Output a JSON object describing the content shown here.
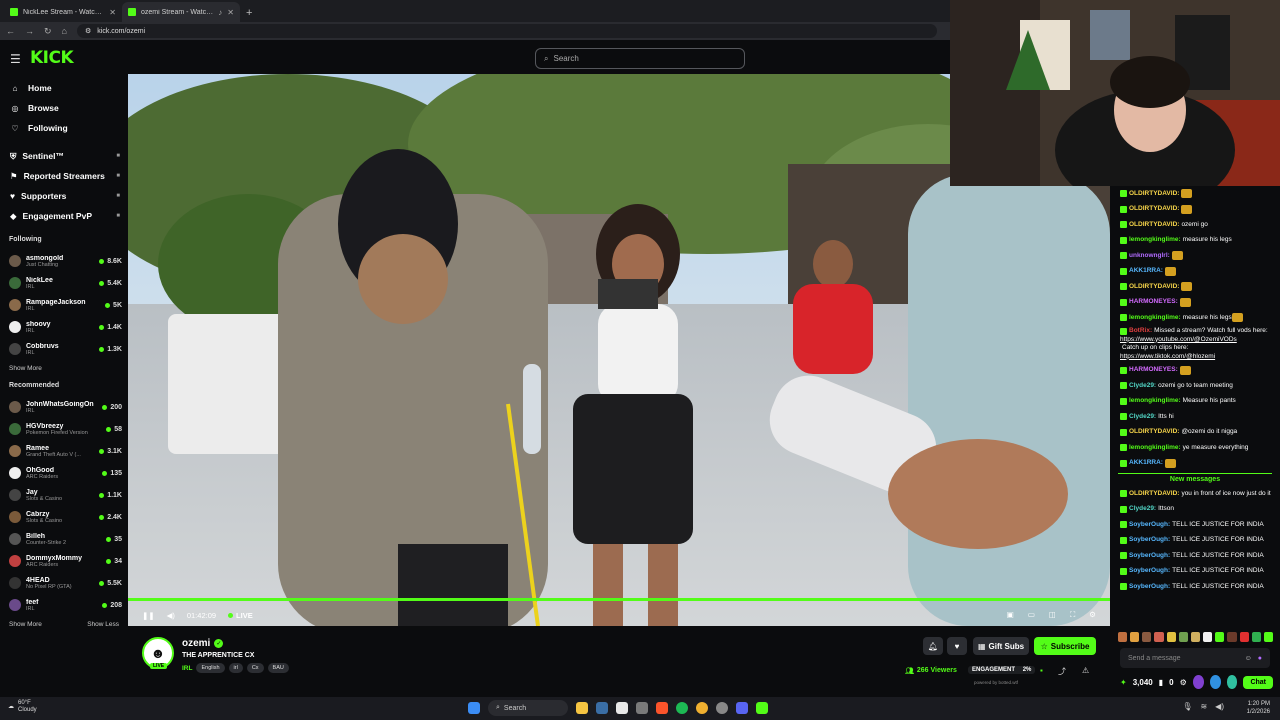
{
  "browser": {
    "tabs": [
      {
        "title": "NickLee Stream - Watch Live on Kick",
        "active": false
      },
      {
        "title": "ozemi Stream - Watch Live on Kick",
        "active": true
      }
    ],
    "url": "kick.com/ozemi"
  },
  "header": {
    "logo": "KICK",
    "search_placeholder": "Search"
  },
  "sidebar": {
    "nav": [
      {
        "label": "Home",
        "icon": "home-icon"
      },
      {
        "label": "Browse",
        "icon": "compass-icon"
      },
      {
        "label": "Following",
        "icon": "heart-icon"
      }
    ],
    "nav2": [
      {
        "label": "Sentinel™"
      },
      {
        "label": "Reported Streamers"
      },
      {
        "label": "Supporters"
      },
      {
        "label": "Engagement PvP"
      }
    ],
    "following_title": "Following",
    "following": [
      {
        "name": "asmongold",
        "category": "Just Chatting",
        "viewers": "8.6K"
      },
      {
        "name": "NickLee",
        "category": "IRL",
        "viewers": "5.4K"
      },
      {
        "name": "RampageJackson",
        "category": "IRL",
        "viewers": "5K"
      },
      {
        "name": "shoovy",
        "category": "IRL",
        "viewers": "1.4K"
      },
      {
        "name": "Cobbruvs",
        "category": "IRL",
        "viewers": "1.3K"
      }
    ],
    "show_more_following": "Show More",
    "recommended_title": "Recommended",
    "recommended": [
      {
        "name": "JohnWhatsGoingOn",
        "category": "IRL",
        "viewers": "200"
      },
      {
        "name": "HGVbreezy",
        "category": "Pokemon Firefed Version",
        "viewers": "58"
      },
      {
        "name": "Ramee",
        "category": "Grand Theft Auto V (...",
        "viewers": "3.1K"
      },
      {
        "name": "OhGood",
        "category": "ARC Raiders",
        "viewers": "135"
      },
      {
        "name": "Jay",
        "category": "Slots & Casino",
        "viewers": "1.1K"
      },
      {
        "name": "Cabrzy",
        "category": "Slots & Casino",
        "viewers": "2.4K"
      },
      {
        "name": "Billeh",
        "category": "Counter-Strike 2",
        "viewers": "35"
      },
      {
        "name": "DommyxMommy",
        "category": "ARC Raiders",
        "viewers": "34"
      },
      {
        "name": "4HEAD",
        "category": "No Pixel RP (GTA)",
        "viewers": "5.5K"
      },
      {
        "name": "feef",
        "category": "IRL",
        "viewers": "208"
      }
    ],
    "show_more": "Show More",
    "show_less": "Show Less"
  },
  "player": {
    "time": "01:42:09",
    "live": "LIVE",
    "progress": 1.0
  },
  "stream": {
    "channel": "ozemi",
    "title": "THE APPRENTICE CX",
    "category": "IRL",
    "tags": [
      "English",
      "irl",
      "Cx",
      "BAU"
    ],
    "viewers": "266 Viewers",
    "engagement": "ENGAGEMENT",
    "engagement_pct": "2%",
    "powered": "powered by botted.wtf",
    "gift_subs": "Gift Subs",
    "subscribe": "Subscribe",
    "live_badge": "LIVE"
  },
  "chat": {
    "messages": [
      {
        "user": "OLDIRTYDAVID:",
        "text": "",
        "color": "#f7d54a",
        "emote": true
      },
      {
        "user": "OLDIRTYDAVID:",
        "text": "",
        "color": "#f7d54a",
        "emote": true
      },
      {
        "user": "OLDIRTYDAVID:",
        "text": "ozemi go",
        "color": "#f7d54a"
      },
      {
        "user": "lemongkinglime:",
        "text": "measure his legs",
        "color": "#53fc18"
      },
      {
        "user": "unknownglrl:",
        "text": "",
        "color": "#b26bff",
        "emote": true
      },
      {
        "user": "AKK1RRA:",
        "text": "",
        "color": "#57b8ff",
        "emote": true
      },
      {
        "user": "OLDIRTYDAVID:",
        "text": "",
        "color": "#f7d54a",
        "emote": true
      },
      {
        "user": "HARMONEYES:",
        "text": "",
        "color": "#d36bff",
        "emote": true
      },
      {
        "user": "lemongkinglime:",
        "text": "measure his legs",
        "color": "#53fc18",
        "emote": true
      },
      {
        "user": "BotRix:",
        "text": "Missed a stream? Watch full vods here:",
        "color": "#e04040",
        "link": "https://www.youtube.com/@OzemiVODs",
        "text2": "Catch up on clips here:",
        "link2": "https://www.tiktok.com/@hlozemi"
      },
      {
        "user": "HARMONEYES:",
        "text": "",
        "color": "#d36bff",
        "emote": true
      },
      {
        "user": "Clyde29:",
        "text": "ozemi go to team meeting",
        "color": "#53d8c8"
      },
      {
        "user": "lemongkinglime:",
        "text": "Measure his pants",
        "color": "#53fc18"
      },
      {
        "user": "Clyde29:",
        "text": "Itts hi",
        "color": "#53d8c8"
      },
      {
        "user": "OLDIRTYDAVID:",
        "text": "@ozemi do it nigga",
        "color": "#f7d54a"
      },
      {
        "user": "lemongkinglime:",
        "text": "ye measure everything",
        "color": "#53fc18"
      },
      {
        "user": "AKK1RRA:",
        "text": "",
        "color": "#57b8ff",
        "emote": true
      }
    ],
    "new_messages_label": "New messages",
    "new_messages": [
      {
        "user": "OLDIRTYDAVID:",
        "text": "you in front of ice now just do it",
        "color": "#f7d54a"
      },
      {
        "user": "Clyde29:",
        "text": "Ittson",
        "color": "#53d8c8"
      },
      {
        "user": "SoyberOugh:",
        "text": "TELL ICE JUSTICE FOR INDIA",
        "color": "#57b8ff"
      },
      {
        "user": "SoyberOugh:",
        "text": "TELL ICE JUSTICE FOR INDIA",
        "color": "#57b8ff"
      },
      {
        "user": "SoyberOugh:",
        "text": "TELL ICE JUSTICE FOR INDIA",
        "color": "#57b8ff"
      },
      {
        "user": "SoyberOugh:",
        "text": "TELL ICE JUSTICE FOR INDIA",
        "color": "#57b8ff"
      },
      {
        "user": "SoyberOugh:",
        "text": "TELL ICE JUSTICE FOR INDIA",
        "color": "#57b8ff"
      }
    ],
    "input_placeholder": "Send a message",
    "points": "3,040",
    "count": "0",
    "chat_button": "Chat"
  },
  "taskbar": {
    "temp": "60°F",
    "weather": "Cloudy",
    "search": "Search",
    "time": "1:20 PM",
    "date": "1/2/2026"
  },
  "colors": {
    "accent": "#53fc18",
    "bg": "#0b0c0e"
  }
}
